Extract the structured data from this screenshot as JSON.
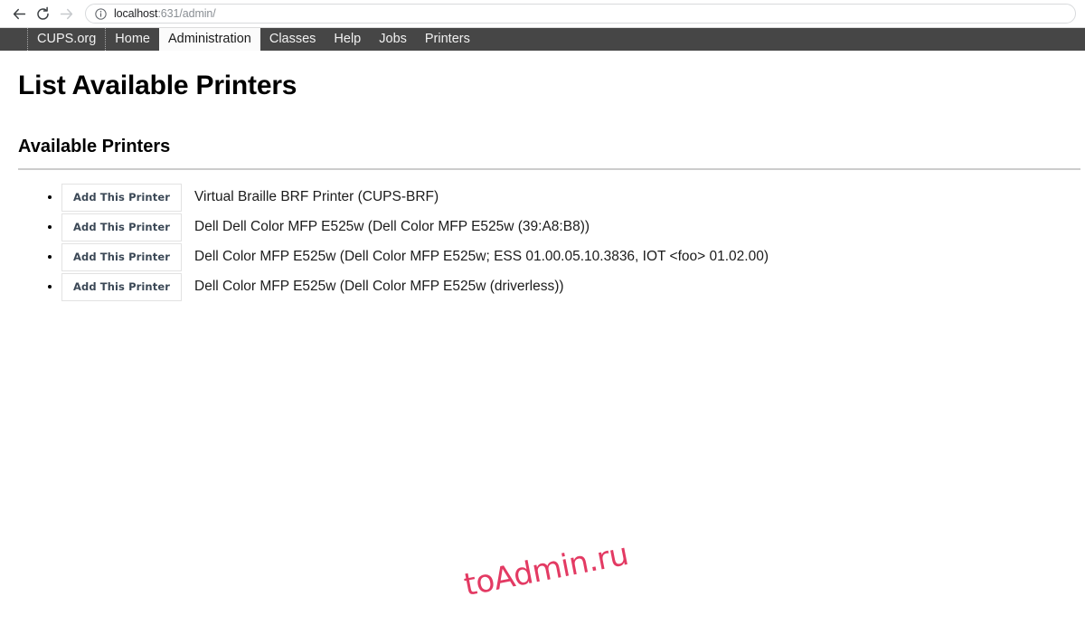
{
  "browser": {
    "back_label": "Back",
    "reload_label": "Reload",
    "forward_label": "Forward",
    "url_host": "localhost",
    "url_rest": ":631/admin/",
    "site_info_label": "Site information"
  },
  "cups_nav": {
    "items": [
      {
        "label": "CUPS.org",
        "active": false
      },
      {
        "label": "Home",
        "active": false
      },
      {
        "label": "Administration",
        "active": true
      },
      {
        "label": "Classes",
        "active": false
      },
      {
        "label": "Help",
        "active": false
      },
      {
        "label": "Jobs",
        "active": false
      },
      {
        "label": "Printers",
        "active": false
      }
    ]
  },
  "page": {
    "title": "List Available Printers",
    "section_title": "Available Printers",
    "button_label": "Add This Printer",
    "printers": [
      {
        "name": "Virtual Braille BRF Printer (CUPS-BRF)"
      },
      {
        "name": "Dell Dell Color MFP E525w (Dell Color MFP E525w (39:A8:B8))"
      },
      {
        "name": "Dell Color MFP E525w (Dell Color MFP E525w; ESS 01.00.05.10.3836, IOT <foo> 01.02.00)"
      },
      {
        "name": "Dell Color MFP E525w (Dell Color MFP E525w (driverless))"
      }
    ]
  },
  "watermark": {
    "text": "toAdmin.ru",
    "color": "#e33a63"
  },
  "colors": {
    "nav_background": "#464646",
    "nav_active_background": "#fbfbfb",
    "rule": "#cccccc",
    "button_border": "#e2e2e2",
    "button_text": "#3b4856"
  }
}
